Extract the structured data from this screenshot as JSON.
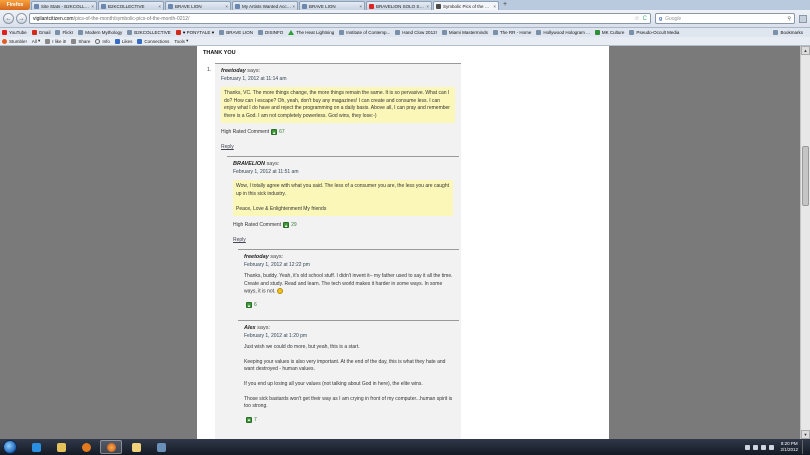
{
  "browser": {
    "menu_button": "Firefox",
    "tabs": [
      {
        "title": "Site Stats - B2KCOLLECTIVE — Wor...",
        "active": false
      },
      {
        "title": "B2KCOLLECTIVE",
        "active": false
      },
      {
        "title": "BRAVE LION",
        "active": false
      },
      {
        "title": "My Artists Wanted Account",
        "active": false
      },
      {
        "title": "BRAVE LION",
        "active": false
      },
      {
        "title": "BRAVELION SOLO SHOW \"HOUSE ...",
        "active": false
      },
      {
        "title": "Symbolic Pics of the Month (02/12...",
        "active": true
      }
    ],
    "new_tab": "+",
    "url_site": "vigilantcitizen.com",
    "url_path": "/pics-of-the-month/symbolic-pics-of-the-month-0212/",
    "search_engine": "g",
    "search_placeholder": "Google",
    "back": "←",
    "forward": "→",
    "star": "☆",
    "reload": "C",
    "search_go": "⚲"
  },
  "bookmarks": [
    {
      "label": "YouTube",
      "icon": "youtube-icon"
    },
    {
      "label": "Gmail",
      "icon": "gmail-icon"
    },
    {
      "label": "Flickr",
      "icon": "flickr-icon"
    },
    {
      "label": "Modern Mythology",
      "icon": "page-icon"
    },
    {
      "label": "B2KCOLLECTIVE",
      "icon": "page-icon"
    },
    {
      "label": "♥ PONYTALE ♥",
      "icon": "heart-icon"
    },
    {
      "label": "BRAVE LION",
      "icon": "page-icon"
    },
    {
      "label": "DISINFO",
      "icon": "page-icon"
    },
    {
      "label": "The Heat Lightning",
      "icon": "triangle-icon"
    },
    {
      "label": "Institute of Contemp...",
      "icon": "page-icon"
    },
    {
      "label": "Hand Clow 2012!",
      "icon": "page-icon"
    },
    {
      "label": "Miami Masterminds",
      "icon": "page-icon"
    },
    {
      "label": "The RR - Home",
      "icon": "page-icon"
    },
    {
      "label": "Hollywood Hologram ...",
      "icon": "page-icon"
    },
    {
      "label": "MK Culture",
      "icon": "page-icon"
    },
    {
      "label": "Pseudo-Occult Media",
      "icon": "page-icon"
    }
  ],
  "bookmarks_end": "Bookmarks",
  "toolbar": {
    "items": [
      "Stumble!",
      "All",
      "I like it!",
      "Share",
      "Info",
      "Likes",
      "Connections",
      "Tools"
    ]
  },
  "page": {
    "thank_you": "THANK YOU",
    "comment_number": "1.",
    "says": "says:",
    "reply_label": "Reply",
    "rated_prefix": "High Rated Comment",
    "comments": [
      {
        "author": "freetoday",
        "date": "February 1, 2012 at 11:14 am",
        "body": [
          "Thanks, VC. The more things change, the more things remain the same. It is so pervasive. What can I do? How can I escape? Oh, yeah, don't buy any magazines! I can create and consume less. I can enjoy what I do have and reject the programming on a daily basis. Above all, I can pray and remember there is a God. I am not completely powerless. God wins, they lose:-)"
        ],
        "rating": "67"
      },
      {
        "author": "BRAVELION",
        "date": "February 1, 2012 at 11:51 am",
        "body": [
          "Wow, I totally agree with what you said. The less of a consumer you are, the less you are caught up in this sick industry.",
          "Peace, Love & Enlightenment My friends"
        ],
        "rating": "29"
      },
      {
        "author": "freetoday",
        "date": "February 1, 2012 at 12:22 pm",
        "body": [
          "Thanks, buddy. Yeah, it's old school stuff. I didn't invent it– my father used to say it all the time. Create and study. Read and learn. The tech world makes it harder in some ways. In some ways, it is not."
        ],
        "rating": "6"
      },
      {
        "author": "Alex",
        "date": "February 1, 2012 at 1:20 pm",
        "body": [
          "Just wish we could do more, but yeah, this is a start.",
          "Keeping your values is also very important. At the end of the day, this is what they hate and want destroyed - human values.",
          "If you end up losing all your values (not talking about God in here), the elite wins.",
          "Those sick bastards won't get their way as I am crying in front of my computer...human spirit is too strong."
        ],
        "rating": "7"
      }
    ]
  },
  "taskbar": {
    "time": "8:20 PM",
    "date": "2/1/2012"
  }
}
